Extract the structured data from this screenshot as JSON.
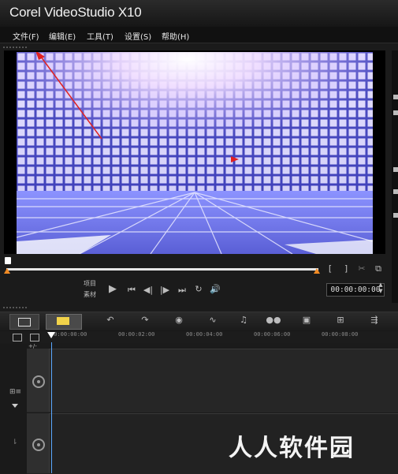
{
  "app": {
    "title": "Corel VideoStudio X10"
  },
  "menu": [
    {
      "label": "文件(F)"
    },
    {
      "label": "编辑(E)"
    },
    {
      "label": "工具(T)"
    },
    {
      "label": "设置(S)"
    },
    {
      "label": "帮助(H)"
    }
  ],
  "preview": {
    "timecode": "00:00:00:00",
    "mode_labels": {
      "project": "项目",
      "clip": "素材"
    },
    "scrub_position": 0.0
  },
  "toolbar": {
    "buttons": [
      "storyboard-view-icon",
      "timeline-view-icon",
      "undo-icon",
      "redo-icon",
      "record-capture-icon",
      "sound-mixer-icon",
      "auto-music-icon",
      "motion-track-icon",
      "subtitle-editor-icon",
      "multi-camera-icon",
      "time-remapping-icon"
    ]
  },
  "ruler": {
    "ticks": [
      "00:00:00:00",
      "00:00:02:00",
      "00:00:04:00",
      "00:00:06:00",
      "00:00:08:00"
    ],
    "zoom_label": "+/-"
  },
  "watermark": {
    "text": "人人软件园"
  },
  "colors": {
    "accent": "#f08a24",
    "playhead": "#5aa8ff",
    "annotation": "#e02020"
  }
}
